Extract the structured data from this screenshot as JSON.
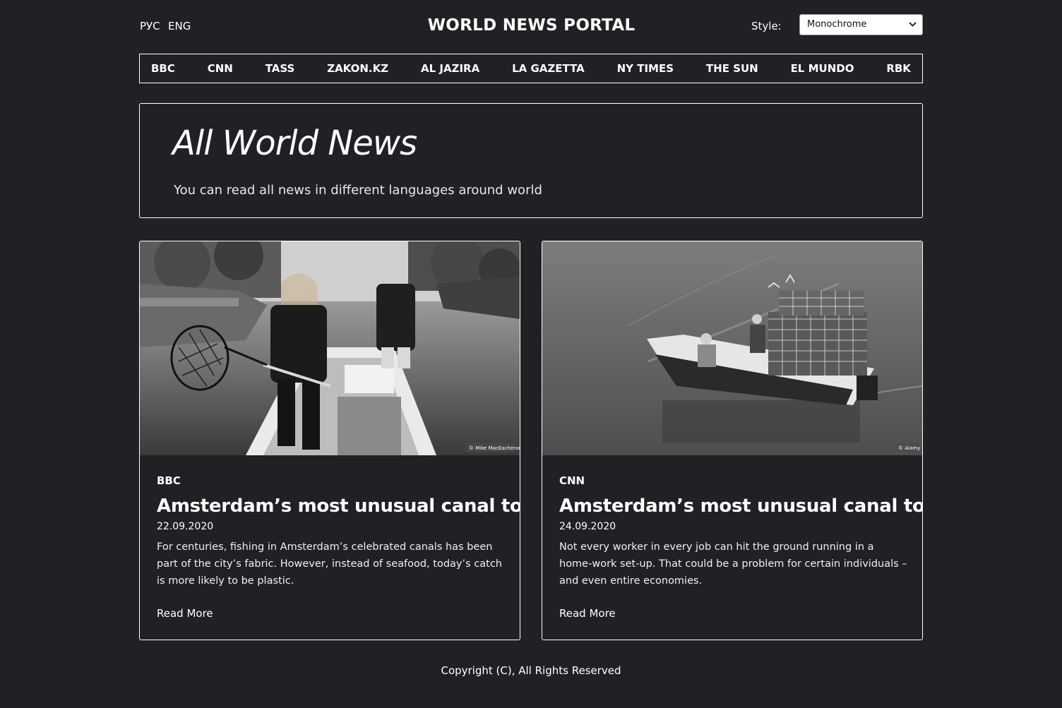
{
  "header": {
    "lang_ru": "РУС",
    "lang_en": "ENG",
    "title": "WORLD NEWS PORTAL",
    "style_label": "Style:",
    "style_selected": "Monochrome"
  },
  "nav": {
    "items": [
      "BBC",
      "CNN",
      "TASS",
      "ZAKON.KZ",
      "AL JAZIRA",
      "LA GAZETTA",
      "NY TIMES",
      "THE SUN",
      "EL MUNDO",
      "RBK"
    ]
  },
  "hero": {
    "title": "All World News",
    "subtitle": "You can read all news in different languages around world"
  },
  "articles": [
    {
      "source": "BBC",
      "title": "Amsterdam’s most unusual canal tour",
      "date": "22.09.2020",
      "text": "For centuries, fishing in Amsterdam’s celebrated canals has been part of the city’s fabric. However, instead of seafood, today’s catch is more likely to be plastic.",
      "read_more": "Read More",
      "image_credit": "© Mike MacEacheran"
    },
    {
      "source": "CNN",
      "title": "Amsterdam’s most unusual canal tour",
      "date": "24.09.2020",
      "text": "Not every worker in every job can hit the ground running in a home-work set-up. That could be a problem for certain individuals – and even entire economies.",
      "read_more": "Read More",
      "image_credit": "© Alamy"
    }
  ],
  "footer": {
    "copyright": "Copyright (C), All Rights Reserved"
  },
  "colors": {
    "background": "#202124",
    "text": "#ffffff",
    "border": "#ffffff"
  }
}
